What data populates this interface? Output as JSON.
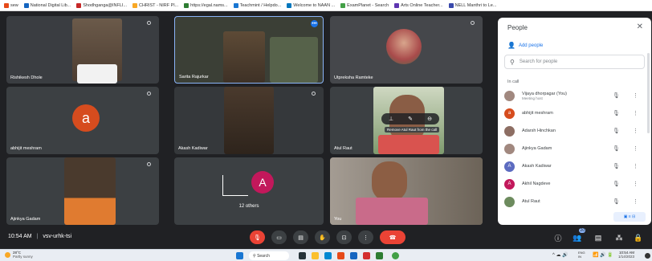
{
  "bookmarks": [
    {
      "label": "sew",
      "color": "#e64a19"
    },
    {
      "label": "National Digital Lib...",
      "color": "#1565c0"
    },
    {
      "label": "Shodhganga@INFLI...",
      "color": "#c62828"
    },
    {
      "label": "CHRIST - NIRF Pl...",
      "color": "#f9a825"
    },
    {
      "label": "https://egal.nams...",
      "color": "#2e7d32"
    },
    {
      "label": "Teachmint / Helpdo...",
      "color": "#1976d2"
    },
    {
      "label": "Welcome to NAAN ...",
      "color": "#0277bd"
    },
    {
      "label": "ExamPlanet - Search",
      "color": "#43a047"
    },
    {
      "label": "Arts Online Teacher...",
      "color": "#5e35b1"
    },
    {
      "label": "NELL Manthri to Le...",
      "color": "#3949ab"
    }
  ],
  "tiles": [
    {
      "name": "Rishikesh Dhole",
      "avatar": "",
      "avatar_color": ""
    },
    {
      "name": "Sarita Rajurkar",
      "avatar": "",
      "avatar_color": ""
    },
    {
      "name": "Utpreksha Ramteke",
      "avatar": "",
      "avatar_color": ""
    },
    {
      "name": "abhijit meshram",
      "avatar": "a",
      "avatar_color": "#d64c1e"
    },
    {
      "name": "Akash Kadiwar",
      "avatar": "",
      "avatar_color": ""
    },
    {
      "name": "Atul Raut",
      "avatar": "",
      "avatar_color": "",
      "tooltip": "Remove Atul Raut from the call"
    },
    {
      "name": "Ajinkya Gadam",
      "avatar": "",
      "avatar_color": ""
    },
    {
      "name": "12 others",
      "avatar": "A",
      "avatar_color": "#c2185b"
    },
    {
      "name": "You",
      "avatar": "",
      "avatar_color": ""
    }
  ],
  "bottom": {
    "time": "10:54 AM",
    "separator": "|",
    "meeting_code": "vsv-urhk-tsi",
    "participant_count": "20"
  },
  "people": {
    "title": "People",
    "add_label": "Add people",
    "search_placeholder": "Search for people",
    "section": "In call",
    "host": {
      "name": "Vijaya dhorpagar (You)",
      "role": "Meeting host"
    },
    "list": [
      {
        "name": "abhijit meshram",
        "initial": "a",
        "color": "#d64c1e"
      },
      {
        "name": "Adarsh Hinchkan",
        "initial": "",
        "color": "#8d6e63"
      },
      {
        "name": "Ajinkya Gadam",
        "initial": "",
        "color": "#a1887f"
      },
      {
        "name": "Akash Kadiwar",
        "initial": "A",
        "color": "#5c6bc0"
      },
      {
        "name": "Akhil Nagdeve",
        "initial": "A",
        "color": "#c2185b"
      },
      {
        "name": "Atul Raut",
        "initial": "",
        "color": "#6d8b5e"
      }
    ]
  },
  "taskbar": {
    "weather_temp": "28°C",
    "weather_desc": "Partly sunny",
    "search_label": "Search",
    "lang": "ENG\nIN",
    "clock_time": "10:54 AM",
    "clock_date": "1/14/2023"
  }
}
